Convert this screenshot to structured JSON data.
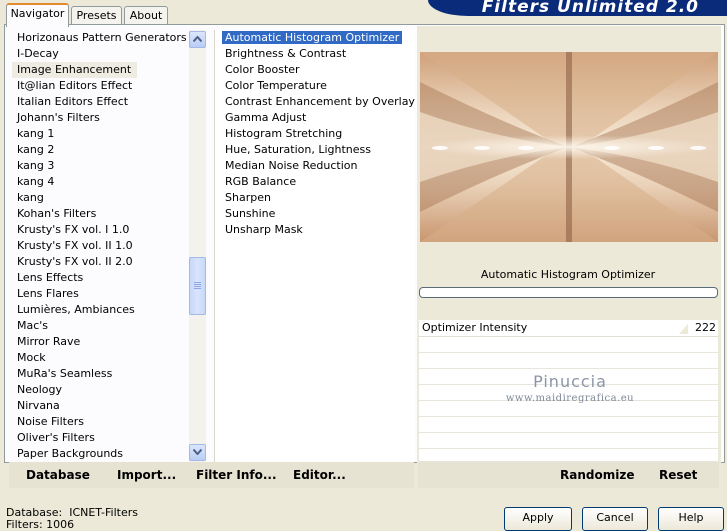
{
  "app_title": "Filters Unlimited 2.0",
  "tabs": [
    {
      "label": "Navigator",
      "active": true
    },
    {
      "label": "Presets",
      "active": false
    },
    {
      "label": "About",
      "active": false
    }
  ],
  "categories": [
    {
      "label": "Horizonaus Pattern Generators"
    },
    {
      "label": "I-Decay"
    },
    {
      "label": "Image Enhancement",
      "selected": true
    },
    {
      "label": "It@lian Editors Effect"
    },
    {
      "label": "Italian Editors Effect"
    },
    {
      "label": "Johann's Filters"
    },
    {
      "label": "kang 1"
    },
    {
      "label": "kang 2"
    },
    {
      "label": "kang 3"
    },
    {
      "label": "kang 4"
    },
    {
      "label": "kang"
    },
    {
      "label": "Kohan's Filters"
    },
    {
      "label": "Krusty's FX vol. I 1.0"
    },
    {
      "label": "Krusty's FX vol. II 1.0"
    },
    {
      "label": "Krusty's FX vol. II 2.0"
    },
    {
      "label": "Lens Effects"
    },
    {
      "label": "Lens Flares"
    },
    {
      "label": "Lumières, Ambiances"
    },
    {
      "label": "Mac's"
    },
    {
      "label": "Mirror Rave"
    },
    {
      "label": "Mock"
    },
    {
      "label": "MuRa's Seamless"
    },
    {
      "label": "Neology"
    },
    {
      "label": "Nirvana"
    },
    {
      "label": "Noise Filters"
    },
    {
      "label": "Oliver's Filters"
    },
    {
      "label": "Paper Backgrounds"
    }
  ],
  "filters": [
    {
      "label": "Automatic Histogram Optimizer",
      "selected": true
    },
    {
      "label": "Brightness & Contrast"
    },
    {
      "label": "Color Booster"
    },
    {
      "label": "Color Temperature"
    },
    {
      "label": "Contrast Enhancement by Overlay"
    },
    {
      "label": "Gamma Adjust"
    },
    {
      "label": "Histogram Stretching"
    },
    {
      "label": "Hue, Saturation, Lightness"
    },
    {
      "label": "Median Noise Reduction"
    },
    {
      "label": "RGB Balance"
    },
    {
      "label": "Sharpen"
    },
    {
      "label": "Sunshine"
    },
    {
      "label": "Unsharp Mask"
    }
  ],
  "preview": {
    "filter_name": "Automatic Histogram Optimizer",
    "progress": 0
  },
  "params": [
    {
      "label": "Optimizer Intensity",
      "value": "222",
      "fraction": 0.87
    }
  ],
  "watermark": {
    "line1": "Pinuccia",
    "line2": "www.maidiregrafica.eu"
  },
  "left_buttons": {
    "database": "Database",
    "import": "Import...",
    "filter_info": "Filter Info...",
    "editor": "Editor..."
  },
  "right_buttons": {
    "randomize": "Randomize",
    "reset": "Reset"
  },
  "status": {
    "database_label": "Database:",
    "database_value": "ICNET-Filters",
    "line2": "Filters:   1006"
  },
  "dialog_buttons": {
    "apply": "Apply",
    "cancel": "Cancel",
    "help": "Help"
  },
  "colors": {
    "selection": "#316ac5",
    "banner": "#0a2a7a",
    "tab_accent": "#e68b2c"
  }
}
